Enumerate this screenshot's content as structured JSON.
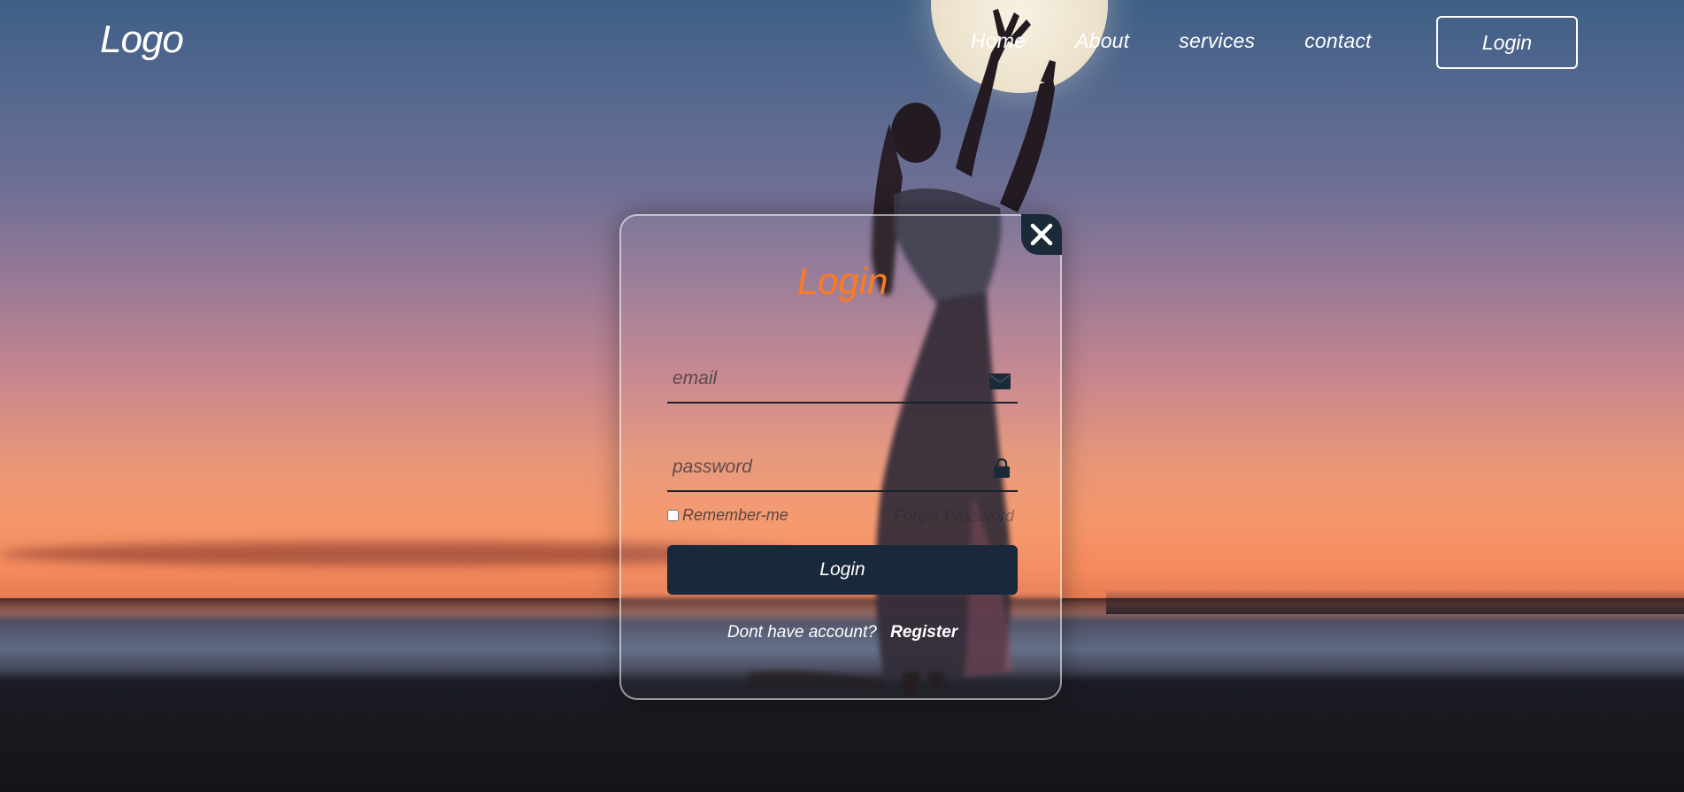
{
  "header": {
    "logo": "Logo",
    "nav": [
      "Home",
      "About",
      "services",
      "contact"
    ],
    "login_button": "Login"
  },
  "modal": {
    "title": "Login",
    "close_icon": "close-icon",
    "email": {
      "placeholder": "email",
      "value": "",
      "icon": "mail-icon"
    },
    "password": {
      "placeholder": "password",
      "value": "",
      "icon": "lock-icon"
    },
    "remember_label": "Remember-me",
    "remember_checked": false,
    "forgot_label": "Forget Password",
    "submit_label": "Login",
    "register_prompt": "Dont have account?",
    "register_link": "Register"
  },
  "colors": {
    "accent": "#ff7a1f",
    "button": "#19283a",
    "text": "#ffffff"
  }
}
